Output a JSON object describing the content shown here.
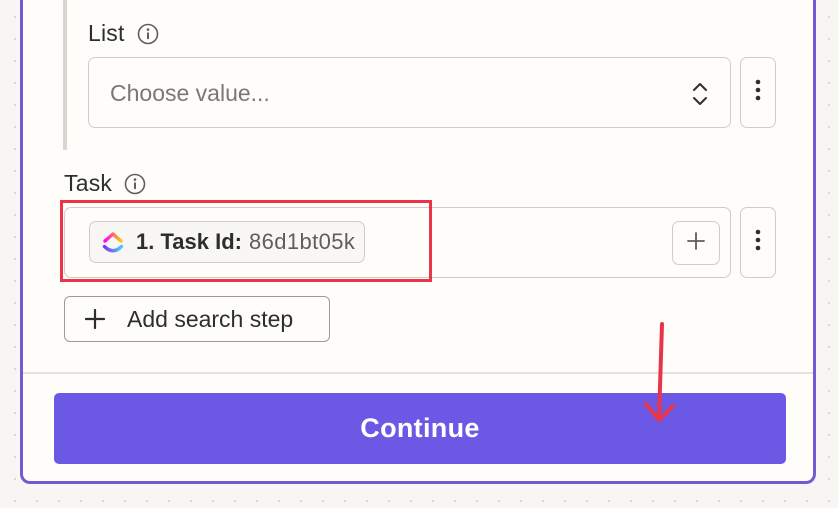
{
  "list_field": {
    "label": "List",
    "placeholder": "Choose value...",
    "info_icon": "info-icon",
    "chevron_icon": "chevron-up-down-icon",
    "menu_icon": "more-vertical-icon"
  },
  "task_field": {
    "label": "Task",
    "info_icon": "info-icon",
    "pill": {
      "app_icon": "clickup-logo",
      "step_label": "1. Task Id:",
      "step_value": "86d1bt05k"
    },
    "add_icon": "plus-icon",
    "menu_icon": "more-vertical-icon"
  },
  "add_search_step": {
    "icon": "plus-icon",
    "label": "Add search step"
  },
  "continue_button": {
    "label": "Continue"
  },
  "annotations": {
    "highlight_color": "#e8354a",
    "arrow_color": "#e8354a",
    "arrow_icon": "arrow-down-icon"
  },
  "colors": {
    "accent": "#6b59e6",
    "panel_border": "#6f5bd6"
  }
}
